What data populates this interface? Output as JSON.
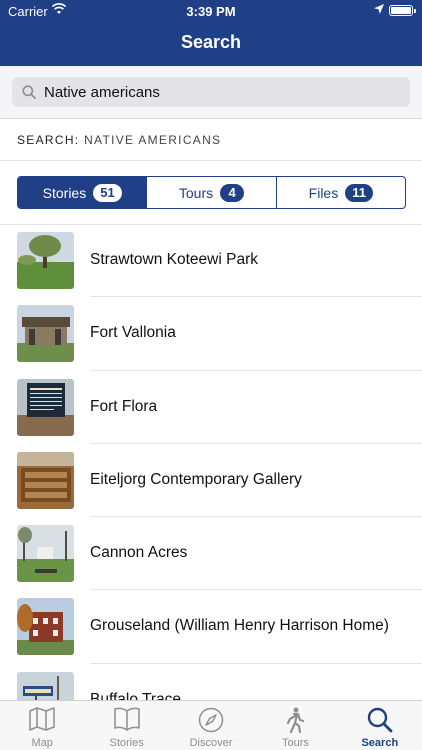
{
  "status": {
    "carrier": "Carrier",
    "time": "3:39 PM"
  },
  "header": {
    "title": "Search"
  },
  "search": {
    "query": "Native americans",
    "label_prefix": "SEARCH:",
    "label_term": "NATIVE AMERICANS"
  },
  "segments": [
    {
      "label": "Stories",
      "count": "51",
      "active": true
    },
    {
      "label": "Tours",
      "count": "4",
      "active": false
    },
    {
      "label": "Files",
      "count": "11",
      "active": false
    }
  ],
  "results": [
    {
      "name": "Strawtown Koteewi Park"
    },
    {
      "name": "Fort Vallonia"
    },
    {
      "name": "Fort Flora"
    },
    {
      "name": "Eiteljorg Contemporary Gallery"
    },
    {
      "name": "Cannon Acres"
    },
    {
      "name": "Grouseland (William Henry Harrison Home)"
    },
    {
      "name": "Buffalo Trace"
    }
  ],
  "tabbar": [
    {
      "label": "Map",
      "icon": "map-icon",
      "active": false
    },
    {
      "label": "Stories",
      "icon": "book-icon",
      "active": false
    },
    {
      "label": "Discover",
      "icon": "compass-icon",
      "active": false
    },
    {
      "label": "Tours",
      "icon": "walking-person-icon",
      "active": false
    },
    {
      "label": "Search",
      "icon": "search-icon",
      "active": true
    }
  ],
  "colors": {
    "brand": "#1f3f86",
    "tab_inactive": "#8e8e93"
  }
}
